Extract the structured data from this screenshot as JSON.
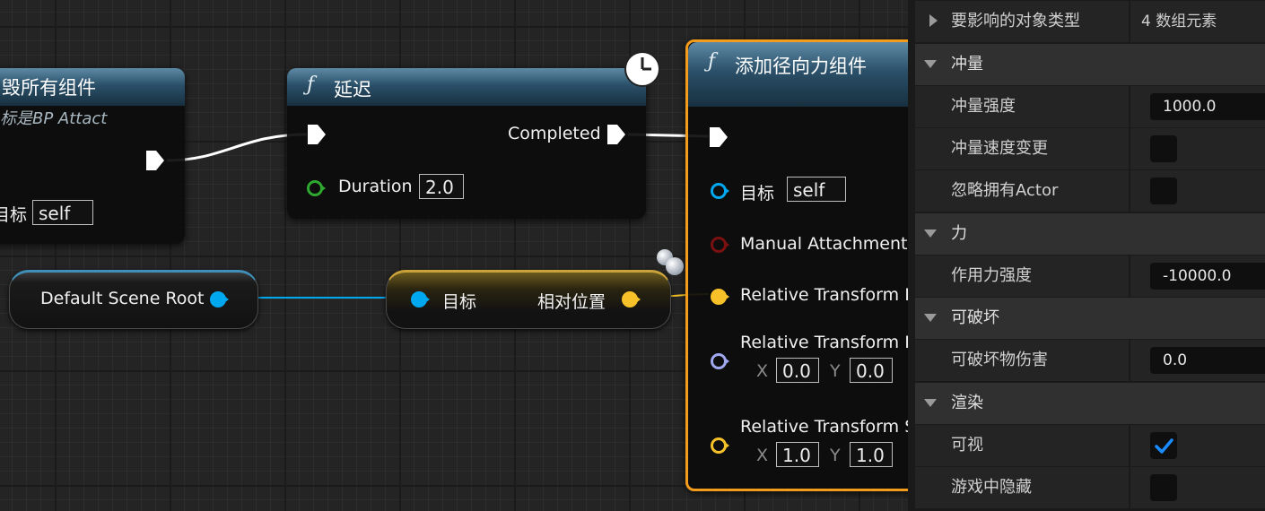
{
  "graph": {
    "node_destroy": {
      "title": "毁所有组件",
      "subtitle": "标是BP Attact",
      "target_label": "目标",
      "target_value": "self"
    },
    "node_delay": {
      "title": "延迟",
      "completed_label": "Completed",
      "duration_label": "Duration",
      "duration_value": "2.0"
    },
    "node_radial": {
      "title": "添加径向力组件",
      "target_label": "目标",
      "target_value": "self",
      "manual_attachment_label": "Manual Attachment",
      "relative_transform_1_label": "Relative Transform L",
      "relative_transform_2_label": "Relative Transform R",
      "rot_x_label": "X",
      "rot_x_value": "0.0",
      "rot_y_label": "Y",
      "rot_y_value": "0.0",
      "relative_transform_3_label": "Relative Transform S",
      "scale_x_label": "X",
      "scale_x_value": "1.0",
      "scale_y_label": "Y",
      "scale_y_value": "1.0"
    },
    "var_scene_root": {
      "label": "Default Scene Root"
    },
    "get_relative_location": {
      "target_label": "目标",
      "output_label": "相对位置"
    },
    "colors": {
      "exec": "#ffffff",
      "object_pin": "#00a8f0",
      "struct_vector_pin": "#f7c12a",
      "bool_pin": "#2ea82e",
      "rotator_pin": "#a0a8f0"
    }
  },
  "details": {
    "rows": [
      {
        "type": "collapsed",
        "label": "要影响的对象类型",
        "value": "4 数组元素"
      },
      {
        "type": "section",
        "label": "冲量"
      },
      {
        "type": "number",
        "label": "冲量强度",
        "value": "1000.0"
      },
      {
        "type": "checkbox",
        "label": "冲量速度变更",
        "checked": false
      },
      {
        "type": "checkbox",
        "label": "忽略拥有Actor",
        "checked": false
      },
      {
        "type": "section",
        "label": "力"
      },
      {
        "type": "number",
        "label": "作用力强度",
        "value": "-10000.0"
      },
      {
        "type": "section",
        "label": "可破坏"
      },
      {
        "type": "number",
        "label": "可破坏物伤害",
        "value": "0.0"
      },
      {
        "type": "section",
        "label": "渲染"
      },
      {
        "type": "checkbox",
        "label": "可视",
        "checked": true
      },
      {
        "type": "checkbox",
        "label": "游戏中隐藏",
        "checked": false
      }
    ]
  }
}
